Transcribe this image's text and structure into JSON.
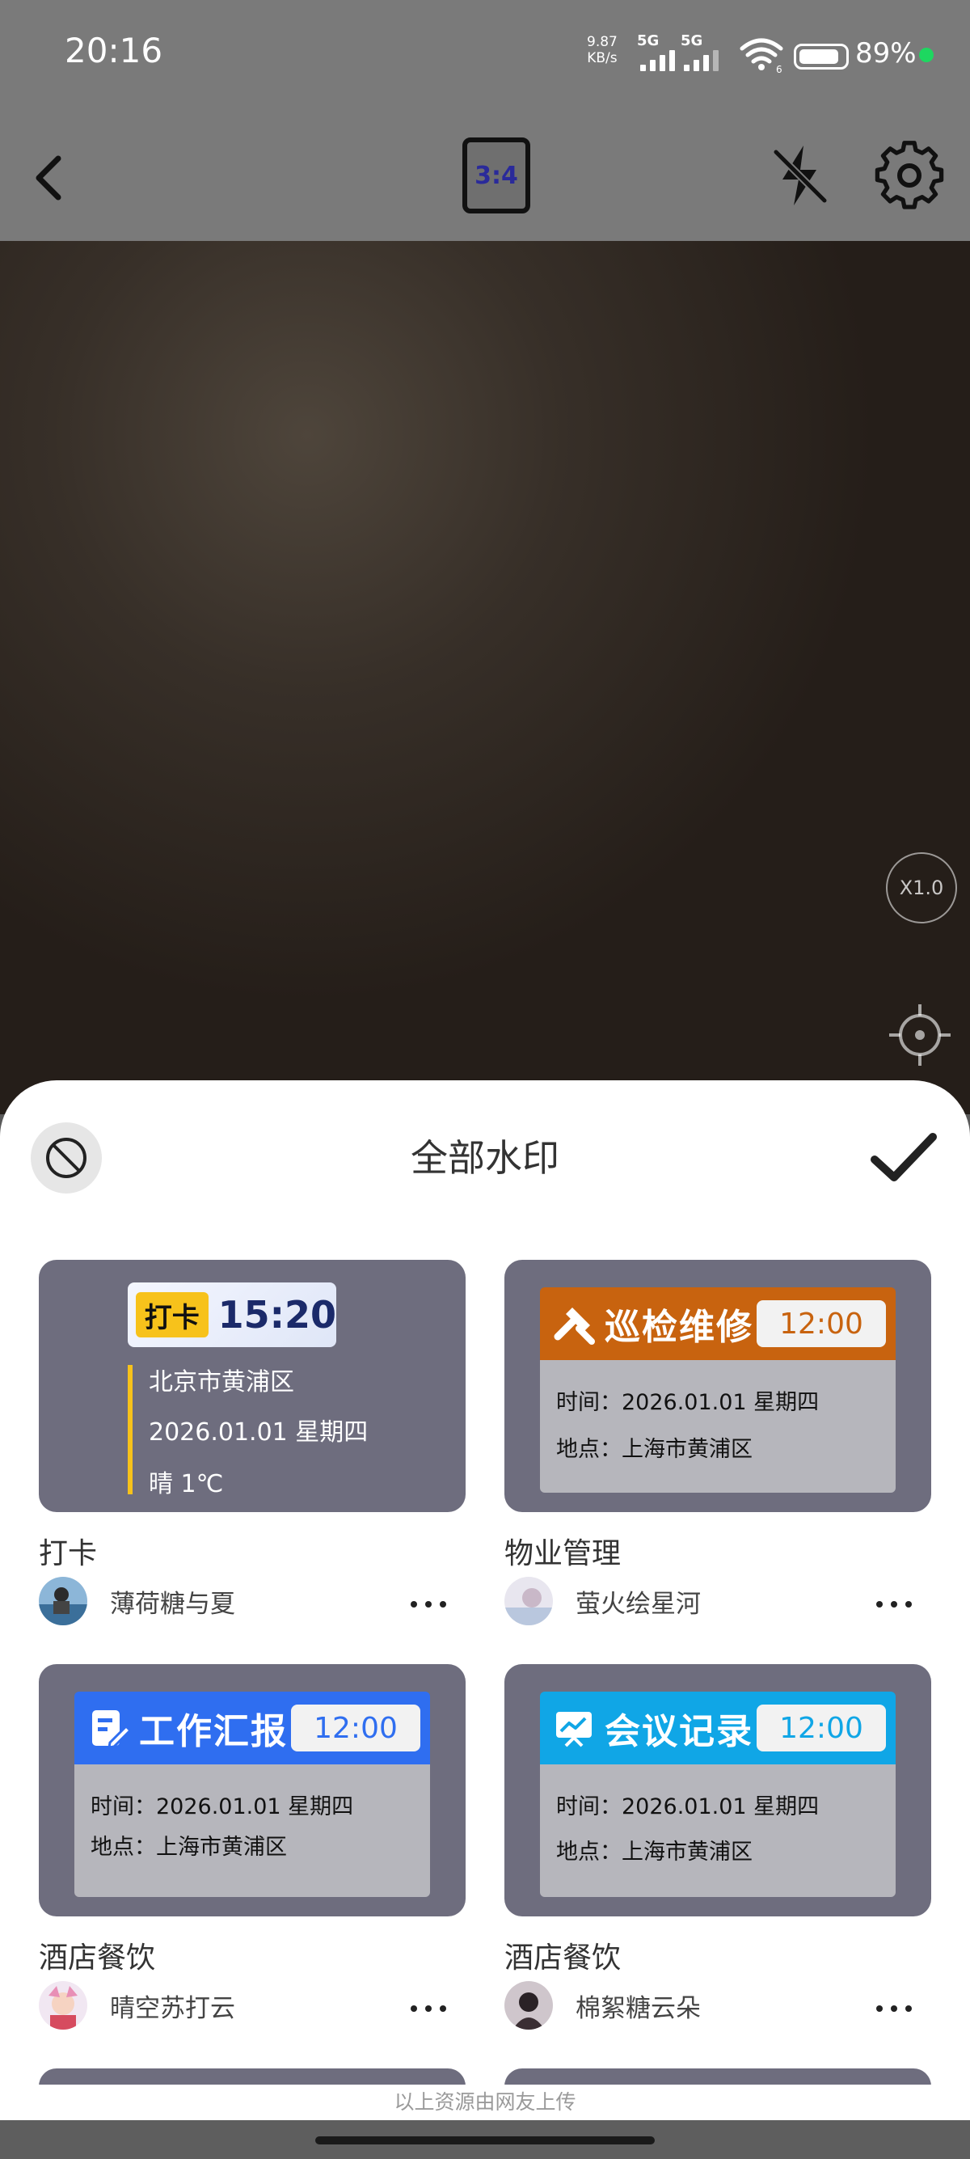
{
  "status_bar": {
    "time": "20:16",
    "net_speed_value": "9.87",
    "net_speed_unit": "KB/s",
    "signal_1_label": "5G",
    "signal_2_label": "5G",
    "battery_percent": "89%",
    "battery_level": 0.89,
    "charging_color": "#1ed760"
  },
  "toolbar": {
    "back_icon": "chevron-left-icon",
    "aspect_ratio": "3:4",
    "flash_icon": "flash-off-icon",
    "settings_icon": "gear-icon"
  },
  "viewfinder": {
    "zoom_label": "X1.0",
    "focus_icon": "crosshair-icon"
  },
  "sheet": {
    "title": "全部水印",
    "no_watermark_icon": "ban-icon",
    "confirm_icon": "check-icon",
    "templates": [
      {
        "name": "打卡",
        "author": "薄荷糖与夏",
        "preview": {
          "tag": "打卡",
          "time": "15:20",
          "lines": [
            "北京市黄浦区",
            "2026.01.01  星期四",
            "晴 1℃"
          ],
          "accent": "#f7c21b"
        }
      },
      {
        "name": "物业管理",
        "author": "萤火绘星河",
        "preview": {
          "title": "巡检维修",
          "time": "12:00",
          "lines": [
            "时间：2026.01.01 星期四",
            "地点：上海市黄浦区"
          ],
          "accent": "#c8630f",
          "icon": "tools-icon"
        }
      },
      {
        "name": "酒店餐饮",
        "author": "晴空苏打云",
        "preview": {
          "title": "工作汇报",
          "time": "12:00",
          "lines": [
            "时间：2026.01.01 星期四",
            "地点：上海市黄浦区"
          ],
          "accent": "#2f6ef0",
          "icon": "edit-note-icon"
        }
      },
      {
        "name": "酒店餐饮",
        "author": "棉絮糖云朵",
        "preview": {
          "title": "会议记录",
          "time": "12:00",
          "lines": [
            "时间：2026.01.01 星期四",
            "地点：上海市黄浦区"
          ],
          "accent": "#10a6e6",
          "icon": "chart-board-icon"
        }
      }
    ],
    "more_icon": "more-horizontal-icon",
    "footer_note": "以上资源由网友上传"
  }
}
